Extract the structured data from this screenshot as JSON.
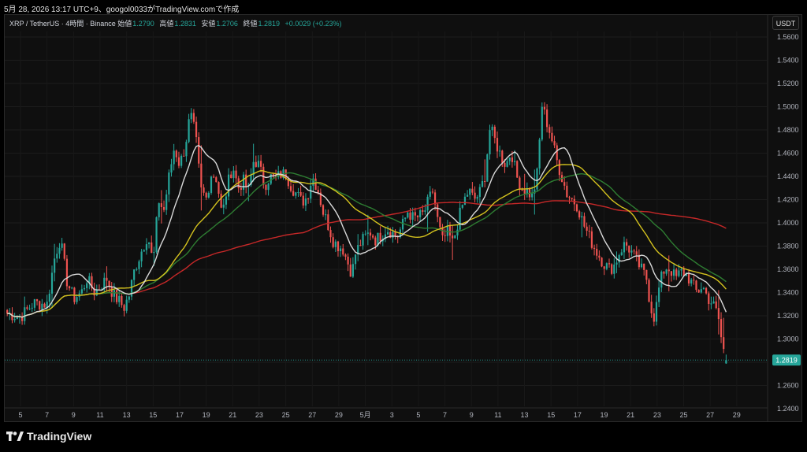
{
  "header": {
    "caption": "5月 28, 2026 13:17 UTC+9、googol0033がTradingView.comで作成"
  },
  "legend": {
    "symbol": "XRP / TetherUS · 4時間 · Binance",
    "open_label": "始値",
    "open": "1.2790",
    "high_label": "高値",
    "high": "1.2831",
    "low_label": "安値",
    "low": "1.2706",
    "close_label": "終値",
    "close": "1.2819",
    "change": "+0.0029 (+0.23%)"
  },
  "currency_button": "USDT",
  "brand": {
    "name": "TradingView"
  },
  "colors": {
    "up": "#26a69a",
    "down": "#ef5350",
    "ema_white": "#d9d9d9",
    "ema_yellow": "#d4c21e",
    "ema_green": "#2e7d32",
    "ema_red": "#c62828"
  },
  "chart_data": {
    "type": "candlestick",
    "price_label": "1.2819",
    "ylim": [
      1.24,
      1.56
    ],
    "yticks": [
      "1.5600",
      "1.5400",
      "1.5200",
      "1.5000",
      "1.4800",
      "1.4600",
      "1.4400",
      "1.4200",
      "1.4000",
      "1.3800",
      "1.3600",
      "1.3400",
      "1.3200",
      "1.3000",
      "1.2800",
      "1.2600",
      "1.2400"
    ],
    "xticks": [
      "5",
      "7",
      "9",
      "11",
      "13",
      "15",
      "17",
      "19",
      "21",
      "23",
      "25",
      "27",
      "29",
      "5月",
      "3",
      "5",
      "7",
      "9",
      "11",
      "13",
      "15",
      "17",
      "19",
      "21",
      "23",
      "25",
      "27",
      "29"
    ],
    "price_path": [
      [
        4,
        1.322
      ],
      [
        5,
        1.319
      ],
      [
        6,
        1.331
      ],
      [
        7,
        1.33
      ],
      [
        7.6,
        1.372
      ],
      [
        8,
        1.386
      ],
      [
        8.5,
        1.35
      ],
      [
        9,
        1.335
      ],
      [
        9.6,
        1.34
      ],
      [
        10,
        1.352
      ],
      [
        10.6,
        1.34
      ],
      [
        11,
        1.345
      ],
      [
        11.5,
        1.352
      ],
      [
        12,
        1.338
      ],
      [
        12.4,
        1.333
      ],
      [
        12.8,
        1.327
      ],
      [
        13.2,
        1.338
      ],
      [
        13.6,
        1.36
      ],
      [
        14,
        1.372
      ],
      [
        14.6,
        1.39
      ],
      [
        15,
        1.364
      ],
      [
        15.4,
        1.42
      ],
      [
        15.8,
        1.41
      ],
      [
        16.2,
        1.44
      ],
      [
        16.6,
        1.465
      ],
      [
        17,
        1.45
      ],
      [
        17.4,
        1.465
      ],
      [
        17.8,
        1.494
      ],
      [
        18.2,
        1.475
      ],
      [
        18.6,
        1.428
      ],
      [
        19,
        1.421
      ],
      [
        19.4,
        1.443
      ],
      [
        19.8,
        1.438
      ],
      [
        20.2,
        1.405
      ],
      [
        20.6,
        1.432
      ],
      [
        21,
        1.45
      ],
      [
        21.4,
        1.43
      ],
      [
        21.8,
        1.436
      ],
      [
        22.2,
        1.428
      ],
      [
        22.6,
        1.455
      ],
      [
        23,
        1.449
      ],
      [
        23.4,
        1.432
      ],
      [
        23.8,
        1.44
      ],
      [
        24.2,
        1.437
      ],
      [
        24.6,
        1.442
      ],
      [
        25,
        1.442
      ],
      [
        25.4,
        1.432
      ],
      [
        25.8,
        1.425
      ],
      [
        26.2,
        1.418
      ],
      [
        26.6,
        1.422
      ],
      [
        27,
        1.44
      ],
      [
        27.4,
        1.43
      ],
      [
        27.8,
        1.41
      ],
      [
        28.2,
        1.398
      ],
      [
        28.6,
        1.384
      ],
      [
        29,
        1.38
      ],
      [
        29.3,
        1.378
      ],
      [
        29.6,
        1.368
      ],
      [
        30,
        1.356
      ],
      [
        30.2,
        1.372
      ],
      [
        30.6,
        1.382
      ],
      [
        31,
        1.388
      ],
      [
        31.4,
        1.392
      ],
      [
        31.8,
        1.385
      ],
      [
        32.2,
        1.39
      ],
      [
        32.6,
        1.395
      ],
      [
        33,
        1.392
      ],
      [
        33.4,
        1.388
      ],
      [
        33.8,
        1.398
      ],
      [
        34.2,
        1.41
      ],
      [
        34.6,
        1.404
      ],
      [
        35,
        1.405
      ],
      [
        35.4,
        1.408
      ],
      [
        35.8,
        1.42
      ],
      [
        36.1,
        1.428
      ],
      [
        36.4,
        1.405
      ],
      [
        36.8,
        1.384
      ],
      [
        37.2,
        1.392
      ],
      [
        37.6,
        1.382
      ],
      [
        38,
        1.402
      ],
      [
        38.4,
        1.418
      ],
      [
        38.8,
        1.428
      ],
      [
        39.2,
        1.42
      ],
      [
        39.6,
        1.425
      ],
      [
        40,
        1.44
      ],
      [
        40.4,
        1.482
      ],
      [
        40.8,
        1.47
      ],
      [
        41.2,
        1.458
      ],
      [
        41.6,
        1.45
      ],
      [
        42,
        1.462
      ],
      [
        42.4,
        1.44
      ],
      [
        42.8,
        1.43
      ],
      [
        43.2,
        1.428
      ],
      [
        43.6,
        1.422
      ],
      [
        44,
        1.445
      ],
      [
        44.3,
        1.502
      ],
      [
        44.6,
        1.49
      ],
      [
        45,
        1.475
      ],
      [
        45.4,
        1.455
      ],
      [
        45.8,
        1.44
      ],
      [
        46.2,
        1.425
      ],
      [
        46.6,
        1.42
      ],
      [
        47,
        1.415
      ],
      [
        47.4,
        1.4
      ],
      [
        47.8,
        1.39
      ],
      [
        48.2,
        1.38
      ],
      [
        48.6,
        1.372
      ],
      [
        49,
        1.365
      ],
      [
        49.4,
        1.36
      ],
      [
        49.8,
        1.364
      ],
      [
        50.2,
        1.376
      ],
      [
        50.6,
        1.382
      ],
      [
        51,
        1.376
      ],
      [
        51.4,
        1.368
      ],
      [
        51.8,
        1.36
      ],
      [
        52.2,
        1.352
      ],
      [
        52.5,
        1.328
      ],
      [
        52.8,
        1.318
      ],
      [
        53.2,
        1.348
      ],
      [
        53.6,
        1.362
      ],
      [
        54,
        1.36
      ],
      [
        54.4,
        1.352
      ],
      [
        54.8,
        1.358
      ],
      [
        55.2,
        1.356
      ],
      [
        55.6,
        1.348
      ],
      [
        56,
        1.34
      ],
      [
        56.4,
        1.346
      ],
      [
        56.8,
        1.336
      ],
      [
        57.2,
        1.33
      ],
      [
        57.6,
        1.32
      ],
      [
        57.9,
        1.295
      ],
      [
        58.2,
        1.282
      ]
    ]
  }
}
